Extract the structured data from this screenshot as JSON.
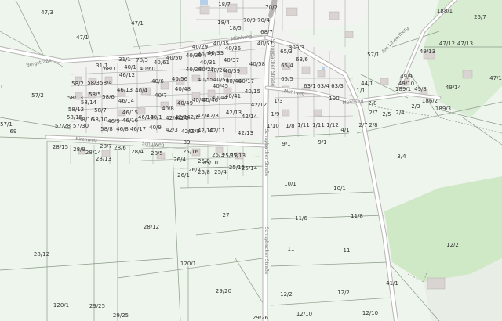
{
  "map": {
    "streets": [
      {
        "id": "bergstrasse",
        "name": "Bergstraße"
      },
      {
        "id": "muehlweg-left",
        "name": "Mühlweg"
      },
      {
        "id": "muehlweg-mid",
        "name": "Mühlweg"
      },
      {
        "id": "muehlweg-right",
        "name": "Mühlweg"
      },
      {
        "id": "schulweg",
        "name": "Schulweg"
      },
      {
        "id": "schupbacher-1",
        "name": "Schupbacher Straße"
      },
      {
        "id": "schupbacher-2",
        "name": "Schupbacher Straße"
      },
      {
        "id": "schupbacher-3",
        "name": "Schupbacher Straße"
      },
      {
        "id": "kirchweg",
        "name": "Kirchweg"
      },
      {
        "id": "am-lindenberg",
        "name": "Am Lindenberg"
      }
    ],
    "parcels": [
      {
        "id": "p1",
        "label": "47/3"
      },
      {
        "id": "p2",
        "label": "47/1"
      },
      {
        "id": "p3",
        "label": "47/1"
      },
      {
        "id": "p4",
        "label": "18/7"
      },
      {
        "id": "p5",
        "label": "70/2"
      },
      {
        "id": "p6",
        "label": "70/9"
      },
      {
        "id": "p7",
        "label": "70/4"
      },
      {
        "id": "p8",
        "label": "18/5"
      },
      {
        "id": "p9",
        "label": "18/4"
      },
      {
        "id": "p10",
        "label": "68/7"
      },
      {
        "id": "p11",
        "label": "40/57"
      },
      {
        "id": "p12",
        "label": "309/3"
      },
      {
        "id": "p13",
        "label": "63/6"
      },
      {
        "id": "p14",
        "label": "65/3"
      },
      {
        "id": "p15",
        "label": "65/4"
      },
      {
        "id": "p16",
        "label": "65/5"
      },
      {
        "id": "p17",
        "label": "63/1"
      },
      {
        "id": "p18",
        "label": "63/4"
      },
      {
        "id": "p19",
        "label": "63/3"
      },
      {
        "id": "p20",
        "label": "57/1"
      },
      {
        "id": "p21",
        "label": "49/13"
      },
      {
        "id": "p22",
        "label": "47/12"
      },
      {
        "id": "p23",
        "label": "47/13"
      },
      {
        "id": "p24",
        "label": "25/7"
      },
      {
        "id": "p25",
        "label": "188/1"
      },
      {
        "id": "p26",
        "label": "49/14"
      },
      {
        "id": "p27",
        "label": "47/1"
      },
      {
        "id": "p28",
        "label": "49/9"
      },
      {
        "id": "p29",
        "label": "49/10"
      },
      {
        "id": "p30",
        "label": "49/8"
      },
      {
        "id": "p31",
        "label": "189/1"
      },
      {
        "id": "p32",
        "label": "186/2"
      },
      {
        "id": "p33",
        "label": "189/3"
      },
      {
        "id": "p34",
        "label": "4/1"
      },
      {
        "id": "p35",
        "label": "44/1"
      },
      {
        "id": "p36",
        "label": "1/1"
      },
      {
        "id": "p37",
        "label": "190"
      },
      {
        "id": "p38",
        "label": "1/10"
      },
      {
        "id": "p39",
        "label": "1/8"
      },
      {
        "id": "p40",
        "label": "1/3"
      },
      {
        "id": "p41",
        "label": "1/11"
      },
      {
        "id": "p42",
        "label": "1/11"
      },
      {
        "id": "p43",
        "label": "1/12"
      },
      {
        "id": "p44",
        "label": "1/9"
      },
      {
        "id": "p45",
        "label": "2/7"
      },
      {
        "id": "p46",
        "label": "2/8"
      },
      {
        "id": "p47",
        "label": "2/5"
      },
      {
        "id": "p48",
        "label": "2/4"
      },
      {
        "id": "p49",
        "label": "2/3"
      },
      {
        "id": "p50",
        "label": "3/4"
      },
      {
        "id": "p51",
        "label": "9/1"
      },
      {
        "id": "p52",
        "label": "9/1"
      },
      {
        "id": "p53",
        "label": "10/1"
      },
      {
        "id": "p54",
        "label": "10/1"
      },
      {
        "id": "p55",
        "label": "11/6"
      },
      {
        "id": "p56",
        "label": "11/8"
      },
      {
        "id": "p57",
        "label": "11"
      },
      {
        "id": "p58",
        "label": "11"
      },
      {
        "id": "p59",
        "label": "12/2"
      },
      {
        "id": "p60",
        "label": "12/2"
      },
      {
        "id": "p61",
        "label": "12/2"
      },
      {
        "id": "p62",
        "label": "12/10"
      },
      {
        "id": "p63",
        "label": "12/10"
      },
      {
        "id": "p64",
        "label": "41/1"
      },
      {
        "id": "p65",
        "label": "27"
      },
      {
        "id": "p66",
        "label": "28/12"
      },
      {
        "id": "p67",
        "label": "28/12"
      },
      {
        "id": "p68",
        "label": "29/20"
      },
      {
        "id": "p69",
        "label": "29/25"
      },
      {
        "id": "p70",
        "label": "29/25"
      },
      {
        "id": "p71",
        "label": "120/1"
      },
      {
        "id": "p72",
        "label": "120/1"
      },
      {
        "id": "p73",
        "label": "29/26"
      },
      {
        "id": "p74",
        "label": "57/2"
      },
      {
        "id": "p75",
        "label": "57/1"
      },
      {
        "id": "p76",
        "label": "69"
      },
      {
        "id": "p77",
        "label": "28/15"
      },
      {
        "id": "p78",
        "label": "28/9"
      },
      {
        "id": "p79",
        "label": "28/7"
      },
      {
        "id": "p80",
        "label": "28/6"
      },
      {
        "id": "p81",
        "label": "28/4"
      },
      {
        "id": "p82",
        "label": "28/5"
      },
      {
        "id": "p83",
        "label": "28/14"
      },
      {
        "id": "p84",
        "label": "28/13"
      },
      {
        "id": "p85",
        "label": "26/4"
      },
      {
        "id": "p86",
        "label": "26/1"
      },
      {
        "id": "p87",
        "label": "25/16"
      },
      {
        "id": "p88",
        "label": "25/3"
      },
      {
        "id": "p89",
        "label": "25/12"
      },
      {
        "id": "p90",
        "label": "25/13"
      },
      {
        "id": "p91",
        "label": "25/15"
      },
      {
        "id": "p92",
        "label": "25/14"
      },
      {
        "id": "p93",
        "label": "25/8"
      },
      {
        "id": "p94",
        "label": "25/4"
      },
      {
        "id": "p95",
        "label": "25/9"
      },
      {
        "id": "p96",
        "label": "25/10"
      },
      {
        "id": "p97",
        "label": "26/2"
      },
      {
        "id": "p98",
        "label": "89"
      },
      {
        "id": "p99",
        "label": "40/1"
      },
      {
        "id": "p100",
        "label": "42/13"
      },
      {
        "id": "p101",
        "label": "42/14"
      },
      {
        "id": "p102",
        "label": "42/12"
      },
      {
        "id": "p103",
        "label": "42/13"
      },
      {
        "id": "p104",
        "label": "40/15"
      },
      {
        "id": "p105",
        "label": "40/17"
      },
      {
        "id": "p106",
        "label": "40/41"
      },
      {
        "id": "p107",
        "label": "40/44"
      },
      {
        "id": "p108",
        "label": "40/40"
      },
      {
        "id": "p109",
        "label": "40/59"
      },
      {
        "id": "p110",
        "label": "40/58"
      },
      {
        "id": "p111",
        "label": "40/37"
      },
      {
        "id": "p112",
        "label": "40/36"
      },
      {
        "id": "p113",
        "label": "40/35"
      },
      {
        "id": "p114",
        "label": "40/33"
      },
      {
        "id": "p115",
        "label": "40/32"
      },
      {
        "id": "p116",
        "label": "40/31"
      },
      {
        "id": "p117",
        "label": "40/30"
      },
      {
        "id": "p118",
        "label": "40/29"
      },
      {
        "id": "p119",
        "label": "40/28"
      },
      {
        "id": "p120",
        "label": "40/27"
      },
      {
        "id": "p121",
        "label": "40/26"
      },
      {
        "id": "p122",
        "label": "40/55"
      },
      {
        "id": "p123",
        "label": "40/56"
      },
      {
        "id": "p124",
        "label": "40/54"
      },
      {
        "id": "p125",
        "label": "40/50"
      },
      {
        "id": "p126",
        "label": "40/48"
      },
      {
        "id": "p127",
        "label": "40/49"
      },
      {
        "id": "p128",
        "label": "40/47"
      },
      {
        "id": "p129",
        "label": "40/46"
      },
      {
        "id": "p130",
        "label": "40/45"
      },
      {
        "id": "p131",
        "label": "40/61"
      },
      {
        "id": "p132",
        "label": "40/60"
      },
      {
        "id": "p133",
        "label": "40/6"
      },
      {
        "id": "p134",
        "label": "40/7"
      },
      {
        "id": "p135",
        "label": "40/8"
      },
      {
        "id": "p136",
        "label": "40/9"
      },
      {
        "id": "p137",
        "label": "42/3"
      },
      {
        "id": "p138",
        "label": "42/4"
      },
      {
        "id": "p139",
        "label": "42/5"
      },
      {
        "id": "p140",
        "label": "42/6"
      },
      {
        "id": "p141",
        "label": "42/7"
      },
      {
        "id": "p142",
        "label": "42/8"
      },
      {
        "id": "p143",
        "label": "42/9"
      },
      {
        "id": "p144",
        "label": "42/10"
      },
      {
        "id": "p145",
        "label": "42/11"
      },
      {
        "id": "p146",
        "label": "42/2"
      },
      {
        "id": "p147",
        "label": "42/1"
      },
      {
        "id": "p148",
        "label": "46/12"
      },
      {
        "id": "p149",
        "label": "46/13"
      },
      {
        "id": "p150",
        "label": "46/14"
      },
      {
        "id": "p151",
        "label": "46/15"
      },
      {
        "id": "p152",
        "label": "46/16"
      },
      {
        "id": "p153",
        "label": "46/17"
      },
      {
        "id": "p154",
        "label": "46/18"
      },
      {
        "id": "p155",
        "label": "46/8"
      },
      {
        "id": "p156",
        "label": "46/9"
      },
      {
        "id": "p157",
        "label": "40/4"
      },
      {
        "id": "p158",
        "label": "58/2"
      },
      {
        "id": "p159",
        "label": "58/3"
      },
      {
        "id": "p160",
        "label": "58/4"
      },
      {
        "id": "p161",
        "label": "58/5"
      },
      {
        "id": "p162",
        "label": "58/6"
      },
      {
        "id": "p163",
        "label": "58/7"
      },
      {
        "id": "p164",
        "label": "58/8"
      },
      {
        "id": "p165",
        "label": "58/12"
      },
      {
        "id": "p166",
        "label": "58/13"
      },
      {
        "id": "p167",
        "label": "58/14"
      },
      {
        "id": "p168",
        "label": "58/15"
      },
      {
        "id": "p169",
        "label": "58/16"
      },
      {
        "id": "p170",
        "label": "58/10"
      },
      {
        "id": "p171",
        "label": "57/28"
      },
      {
        "id": "p172",
        "label": "57/30"
      },
      {
        "id": "p173",
        "label": "31/1"
      },
      {
        "id": "p174",
        "label": "31/1"
      },
      {
        "id": "p175",
        "label": "70/3"
      },
      {
        "id": "p176",
        "label": "68/1"
      },
      {
        "id": "p177",
        "label": "40/1"
      },
      {
        "id": "p178",
        "label": "1"
      },
      {
        "id": "p179",
        "label": "2/7"
      },
      {
        "id": "p180",
        "label": "2/8"
      }
    ]
  }
}
